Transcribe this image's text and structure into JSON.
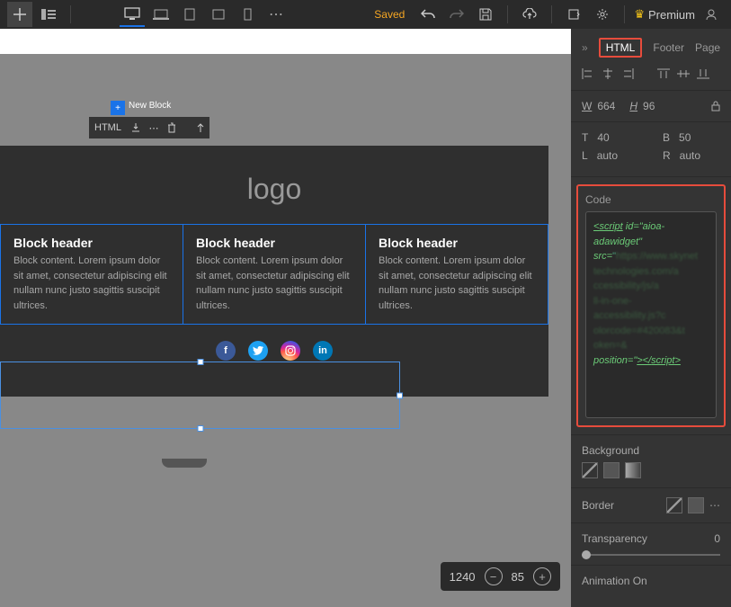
{
  "toolbar": {
    "saved_label": "Saved",
    "premium_label": "Premium"
  },
  "block_toolbar": {
    "label": "HTML",
    "new_block_label": "New Block"
  },
  "page": {
    "logo": "logo",
    "blocks": [
      {
        "header": "Block header",
        "content": "Block content. Lorem ipsum dolor sit amet, consectetur adipiscing elit nullam nunc justo sagittis suscipit ultrices."
      },
      {
        "header": "Block header",
        "content": "Block content. Lorem ipsum dolor sit amet, consectetur adipiscing elit nullam nunc justo sagittis suscipit ultrices."
      },
      {
        "header": "Block header",
        "content": "Block content. Lorem ipsum dolor sit amet, consectetur adipiscing elit nullam nunc justo sagittis suscipit ultrices."
      }
    ]
  },
  "zoom": {
    "value1": "1240",
    "pct": "85"
  },
  "panel": {
    "tabs": {
      "html": "HTML",
      "footer": "Footer",
      "page": "Page"
    },
    "width_label": "W",
    "width": "664",
    "height_label": "H",
    "height": "96",
    "pos": {
      "T": "40",
      "B": "50",
      "L": "auto",
      "R": "auto"
    },
    "code_label": "Code",
    "code": {
      "line1_open": "<",
      "line1_tag": "script",
      "line1_rest": " id=\"aioa-adawidget\"",
      "line2": "src=",
      "line_end_pre": "position=\"",
      "line_end_open": "></",
      "line_end_tag": "script",
      "line_end_close": ">"
    },
    "background_label": "Background",
    "border_label": "Border",
    "transparency_label": "Transparency",
    "transparency_value": "0",
    "animation_label": "Animation On"
  }
}
